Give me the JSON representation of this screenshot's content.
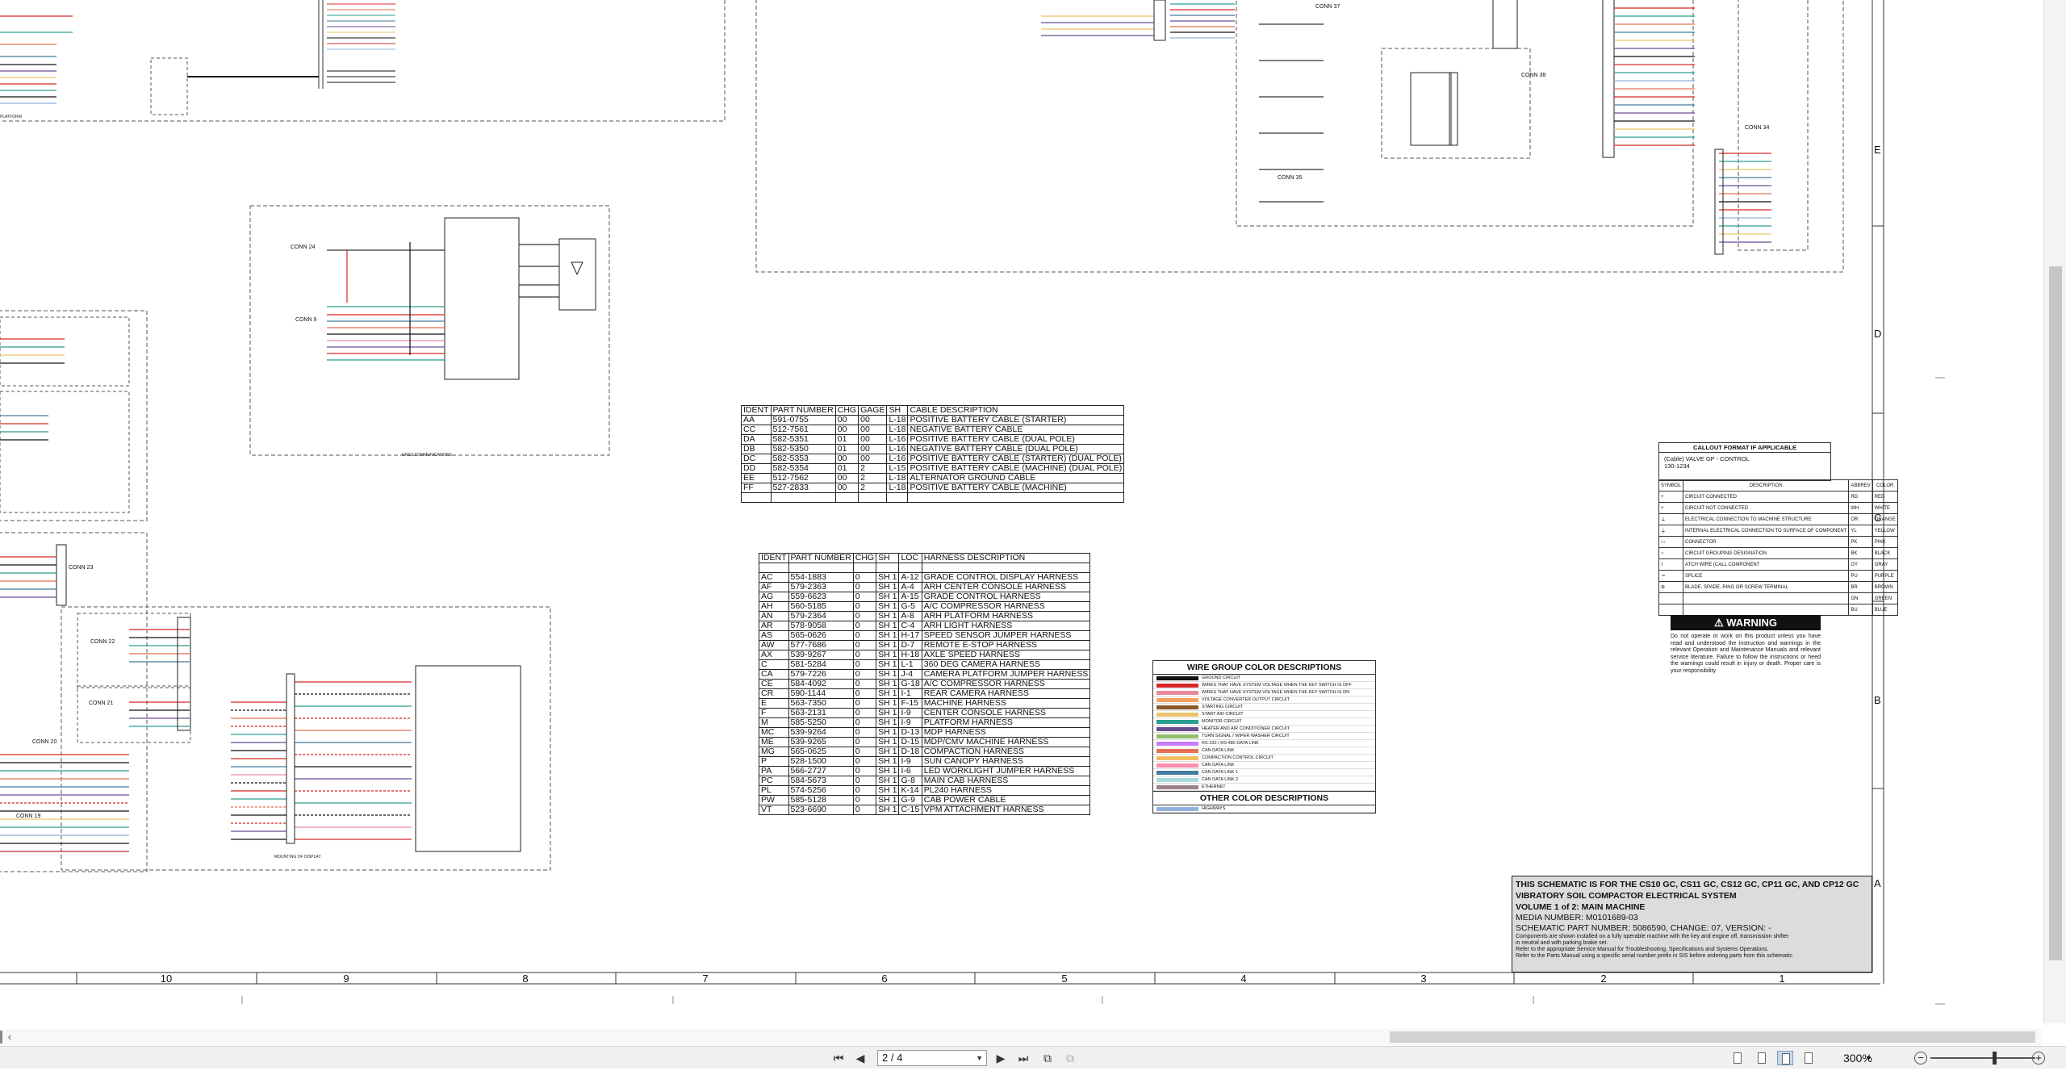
{
  "cable_table": {
    "headers": [
      "IDENT",
      "PART NUMBER",
      "CHG",
      "GAGE",
      "SH",
      "CABLE DESCRIPTION"
    ],
    "rows": [
      [
        "AA",
        "591-0755",
        "00",
        "00",
        "L-18",
        "POSITIVE BATTERY CABLE (STARTER)"
      ],
      [
        "CC",
        "512-7561",
        "00",
        "00",
        "L-18",
        "NEGATIVE BATTERY CABLE"
      ],
      [
        "DA",
        "582-5351",
        "01",
        "00",
        "L-16",
        "POSITIVE BATTERY CABLE  (DUAL POLE)"
      ],
      [
        "DB",
        "582-5350",
        "01",
        "00",
        "L-16",
        "NEGATIVE BATTERY CABLE (DUAL POLE)"
      ],
      [
        "DC",
        "582-5353",
        "00",
        "00",
        "L-16",
        "POSITIVE BATTERY CABLE (STARTER) (DUAL POLE)"
      ],
      [
        "DD",
        "582-5354",
        "01",
        "2",
        "L-15",
        "POSITIVE BATTERY CABLE (MACHINE) (DUAL POLE)"
      ],
      [
        "EE",
        "512-7562",
        "00",
        "2",
        "L-18",
        "ALTERNATOR GROUND CABLE"
      ],
      [
        "FF",
        "527-2833",
        "00",
        "2",
        "L-18",
        "POSITIVE BATTERY CABLE (MACHINE)"
      ],
      [
        "",
        "",
        "",
        "",
        "",
        ""
      ]
    ]
  },
  "harness_table": {
    "headers": [
      "IDENT",
      "PART NUMBER",
      "CHG",
      "SH",
      "LOC",
      "HARNESS DESCRIPTION"
    ],
    "rows": [
      [
        "",
        "",
        "",
        "",
        "",
        ""
      ],
      [
        "AC",
        "554-1883",
        "0",
        "SH 1",
        "A-12",
        "GRADE CONTROL DISPLAY HARNESS"
      ],
      [
        "AF",
        "579-2363",
        "0",
        "SH 1",
        "A-4",
        "ARH CENTER CONSOLE HARNESS"
      ],
      [
        "AG",
        "559-6623",
        "0",
        "SH 1",
        "A-15",
        "GRADE CONTROL HARNESS"
      ],
      [
        "AH",
        "560-5185",
        "0",
        "SH 1",
        "G-5",
        "A/C COMPRESSOR HARNESS"
      ],
      [
        "AN",
        "579-2364",
        "0",
        "SH 1",
        "A-8",
        "ARH PLATFORM HARNESS"
      ],
      [
        "AR",
        "578-9058",
        "0",
        "SH 1",
        "C-4",
        "ARH LIGHT HARNESS"
      ],
      [
        "AS",
        "565-0626",
        "0",
        "SH 1",
        "H-17",
        "SPEED SENSOR JUMPER HARNESS"
      ],
      [
        "AW",
        "577-7686",
        "0",
        "SH 1",
        "D-7",
        "REMOTE E-STOP HARNESS"
      ],
      [
        "AX",
        "539-9267",
        "0",
        "SH 1",
        "H-18",
        "AXLE SPEED HARNESS"
      ],
      [
        "C",
        "581-5284",
        "0",
        "SH 1",
        "L-1",
        "360 DEG CAMERA HARNESS"
      ],
      [
        "CA",
        "579-7226",
        "0",
        "SH 1",
        "J-4",
        "CAMERA PLATFORM JUMPER HARNESS"
      ],
      [
        "CE",
        "584-4092",
        "0",
        "SH 1",
        "G-18",
        "A/C COMPRESSOR HARNESS"
      ],
      [
        "CR",
        "590-1144",
        "0",
        "SH 1",
        "I-1",
        "REAR CAMERA HARNESS"
      ],
      [
        "E",
        "563-7350",
        "0",
        "SH 1",
        "F-15",
        "MACHINE HARNESS"
      ],
      [
        "F",
        "563-2131",
        "0",
        "SH 1",
        "I-9",
        "CENTER CONSOLE HARNESS"
      ],
      [
        "M",
        "585-5250",
        "0",
        "SH 1",
        "I-9",
        "PLATFORM HARNESS"
      ],
      [
        "MC",
        "539-9264",
        "0",
        "SH 1",
        "D-13",
        "MDP HARNESS"
      ],
      [
        "ME",
        "539-9265",
        "0",
        "SH 1",
        "D-15",
        "MDP/CMV MACHINE HARNESS"
      ],
      [
        "MG",
        "565-0625",
        "0",
        "SH 1",
        "D-18",
        "COMPACTION HARNESS"
      ],
      [
        "P",
        "528-1500",
        "0",
        "SH 1",
        "I-9",
        "SUN CANOPY HARNESS"
      ],
      [
        "PA",
        "566-2727",
        "0",
        "SH 1",
        "I-6",
        "LED WORKLIGHT JUMPER HARNESS"
      ],
      [
        "PC",
        "584-5673",
        "0",
        "SH 1",
        "G-8",
        "MAIN CAB HARNESS"
      ],
      [
        "PL",
        "574-5256",
        "0",
        "SH 1",
        "K-14",
        "PL240 HARNESS"
      ],
      [
        "PW",
        "585-5128",
        "0",
        "SH 1",
        "G-9",
        "CAB POWER CABLE"
      ],
      [
        "VT",
        "523-6690",
        "0",
        "SH 1",
        "C-15",
        "VPM ATTACHMENT HARNESS"
      ]
    ]
  },
  "wire_legend": {
    "title": "WIRE GROUP COLOR DESCRIPTIONS",
    "items": [
      {
        "label": "GROUND CIRCUIT",
        "color": "#111111"
      },
      {
        "label": "WIRES THAT HAVE SYSTEM VOLTAGE WHEN THE KEY SWITCH IS OFF",
        "color": "#d62828"
      },
      {
        "label": "WIRES THAT HAVE SYSTEM VOLTAGE WHEN THE KEY SWITCH IS ON",
        "color": "#e98a9a"
      },
      {
        "label": "VOLTAGE CONVERTER OUTPUT CIRCUIT",
        "color": "#f4a261"
      },
      {
        "label": "STARTING CIRCUIT",
        "color": "#8b5a2b"
      },
      {
        "label": "START AID CIRCUIT",
        "color": "#e9c46a"
      },
      {
        "label": "MONITOR CIRCUIT",
        "color": "#2a9d8f"
      },
      {
        "label": "HEATER AND AIR CONDITIONER CIRCUIT",
        "color": "#6a4c93"
      },
      {
        "label": "TURN SIGNAL / WIPER WASHER CIRCUIT",
        "color": "#90be6d"
      },
      {
        "label": "RS-232 / RS-485 DATA LINK",
        "color": "#c77dff"
      },
      {
        "label": "CAN DATA LINK",
        "color": "#e76f51"
      },
      {
        "label": "COMPACTION CONTROL CIRCUIT",
        "color": "#f6bd60"
      },
      {
        "label": "CAN DATA LINK",
        "color": "#ff8fab"
      },
      {
        "label": "CAN DATA LINK 1",
        "color": "#457b9d"
      },
      {
        "label": "CAN DATA LINK 2",
        "color": "#a8dadc"
      },
      {
        "label": "ETHERNET",
        "color": "#9d8189"
      }
    ],
    "other_title": "OTHER COLOR DESCRIPTIONS",
    "other_items": [
      {
        "label": "HIGHWAYS",
        "color": "#8fb3de"
      }
    ]
  },
  "callout": {
    "title": "CALLOUT FORMAT IF APPLICABLE",
    "text": "(Cable) VALVE GP - CONTROL",
    "part": "130-1234"
  },
  "symbol_legend": {
    "headers": [
      "SYMBOL",
      "DESCRIPTION",
      "ABBREV",
      "COLOR"
    ],
    "rows": [
      [
        "+",
        "CIRCUIT CONNECTED",
        "RD",
        "RED"
      ],
      [
        "+",
        "CIRCUIT NOT CONNECTED",
        "WH",
        "WHITE"
      ],
      [
        "⏚",
        "ELECTRICAL CONNECTION TO MACHINE STRUCTURE",
        "OR",
        "ORANGE"
      ],
      [
        "⏚",
        "INTERNAL ELECTRICAL CONNECTION TO SURFACE OF COMPONENT",
        "YL",
        "YELLOW"
      ],
      [
        "▭",
        "CONNECTOR",
        "PK",
        "PINK"
      ],
      [
        "○",
        "CIRCUIT GROUPING DESIGNATION",
        "BK",
        "BLACK"
      ],
      [
        "⌇",
        "ATCH WIRE (CALL COMPONENT",
        "GY",
        "GRAY"
      ],
      [
        "⊸",
        "SPLICE",
        "PU",
        "PURPLE"
      ],
      [
        "⊕",
        "BLADE, SPADE, RING OR SCREW TERMINAL",
        "BR",
        "BROWN"
      ],
      [
        "",
        "",
        "GN",
        "GREEN"
      ],
      [
        "",
        "",
        "BU",
        "BLUE"
      ]
    ]
  },
  "warning": {
    "title": "WARNING",
    "text": "Do not operate or work on this product unless you have read and understood the instruction and warnings in the relevant Operation and Maintenance Manuals and relevant service literature. Failure to follow the instructions or heed the warnings could result in injury or death. Proper care is your responsibility."
  },
  "title_block": {
    "line1": "THIS SCHEMATIC IS FOR THE CS10 GC, CS11 GC, CS12 GC, CP11 GC, AND CP12 GC",
    "line2": "VIBRATORY SOIL COMPACTOR ELECTRICAL SYSTEM",
    "line3": "VOLUME 1 of 2: MAIN MACHINE",
    "media": "MEDIA NUMBER: M0101689-03",
    "part": "SCHEMATIC PART NUMBER: 5086590, CHANGE: 07, VERSION: -",
    "note1": "Components are shown installed on a fully operable machine with the key and engine off, transmission shifter",
    "note2": "in neutral and with parking brake set.",
    "note3": "Refer to the appropriate Service Manual for Troubleshooting, Specifications and Systems Operations.",
    "note4": "Refer to the Parts Manual using a specific serial number prefix in SIS before ordering parts from this schematic."
  },
  "schematic_labels": {
    "conn24": "CONN 24",
    "conn9": "CONN 9",
    "conn23": "CONN 23",
    "conn22": "CONN 22",
    "conn21": "CONN 21",
    "conn20": "CONN 20",
    "conn19": "CONN 19",
    "conn37": "CONN 37",
    "conn38": "CONN 38",
    "conn35": "CONN 35",
    "conn34": "CONN 34",
    "platform": "PLATFORM",
    "gnss": "GNSS COMMUNICATIONS",
    "mounting": "MOUNTING OF DISPLAY"
  },
  "border": {
    "columns": [
      "10",
      "9",
      "8",
      "7",
      "6",
      "5",
      "4",
      "3",
      "2",
      "1"
    ],
    "rows": [
      "E",
      "D",
      "C",
      "B",
      "A"
    ]
  },
  "toolbar": {
    "page_value": "2 / 4",
    "zoom": "300%"
  }
}
